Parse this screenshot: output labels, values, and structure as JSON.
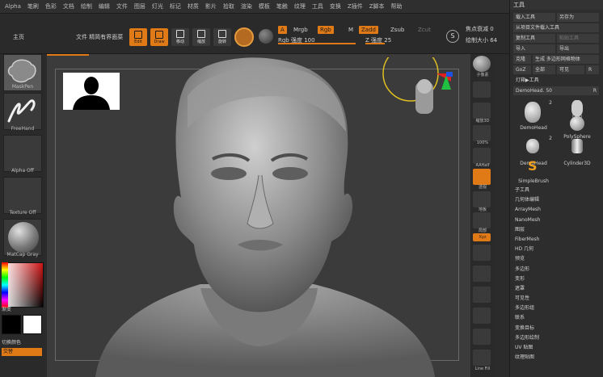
{
  "menu": {
    "items": [
      "Alpha",
      "笔刷",
      "色彩",
      "文档",
      "绘制",
      "编辑",
      "文件",
      "图层",
      "灯光",
      "标记",
      "材质",
      "影片",
      "拾取",
      "渲染",
      "模板",
      "笔触",
      "纹理",
      "工具",
      "变换",
      "Z插件",
      "Z脚本",
      "帮助"
    ]
  },
  "toolbar": {
    "home_label": "主页",
    "lightbox_label": "文件 精简有界面菜",
    "edit_label": "Edit",
    "draw_label": "Draw",
    "move_label": "移动",
    "scale_label": "缩放",
    "rotate_label": "旋转",
    "chips": {
      "a": "A",
      "mrgb": "Mrgb",
      "rgb": "Rgb",
      "m": "M",
      "zadd": "Zadd",
      "zsub": "Zsub",
      "zcut": "Zcut"
    },
    "rgb_intensity_label": "Rgb 强度 100",
    "z_intensity_label": "Z 强度 25",
    "focal_label": "焦点衰减 0",
    "draw_size_label": "绘制大小 64",
    "s_label": "S"
  },
  "left": {
    "brush_label": "MaskPen",
    "stroke_label": "FreeHand",
    "alpha_label": "Alpha Off",
    "texture_label": "Texture Off",
    "material_label": "MatCap Gray",
    "gradient_label": "渐变",
    "switch_color_label": "切换颜色",
    "alternate_label": "交替"
  },
  "right_strip": {
    "labels": [
      "子像素",
      "SPix 3",
      "缩放3D",
      "100%",
      "AAHalf",
      "透视",
      "地板",
      "局部",
      "Xyz",
      "",
      "",
      "",
      "移动",
      "缩放",
      "旋转",
      "Line Fill"
    ]
  },
  "tool_panel": {
    "title": "工具",
    "load_tool": "载入工具",
    "save_as": "另存为",
    "load_from_project": "从项目文件载入工具",
    "copy_tool": "复制工具",
    "paste_tool": "粘贴工具",
    "import": "导入",
    "export": "导出",
    "clone": "克隆",
    "make_polymesh": "生成 多边形网格物体",
    "goz": "GoZ",
    "all": "全部",
    "visible": "可见",
    "r": "R",
    "lightbox_tools": "灯箱▶工具",
    "current_tool": "DemoHead. 50",
    "r2": "R",
    "subtools": [
      {
        "label": "DemoHead",
        "badge": "2"
      },
      {
        "label": "Dog",
        "badge": ""
      },
      {
        "label": "PolySphere",
        "badge": ""
      },
      {
        "label": "DemoHead",
        "badge": "2"
      },
      {
        "label": "Cylinder3D",
        "badge": ""
      },
      {
        "label": "SimpleBrush",
        "badge": ""
      }
    ],
    "list": [
      "子工具",
      "几何体编辑",
      "ArrayMesh",
      "NanoMesh",
      "图层",
      "FiberMesh",
      "HD 几何",
      "预览",
      "多边形",
      "变形",
      "遮罩",
      "可见性",
      "多边形组",
      "联系",
      "变换目标",
      "多边形绘制",
      "UV 贴图",
      "纹理贴图"
    ]
  },
  "colors": {
    "accent": "#e07a16",
    "panel": "#2d2d2d",
    "canvas": "#3b3b3b"
  }
}
